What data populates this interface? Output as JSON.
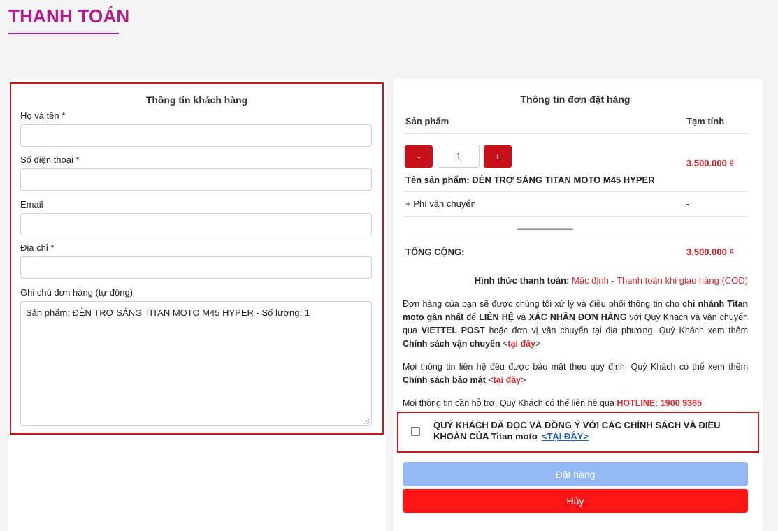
{
  "page": {
    "title": "THANH TOÁN"
  },
  "customer": {
    "section_title": "Thông tin khách hàng",
    "name_label": "Họ và tên *",
    "phone_label": "Số điện thoại *",
    "email_label": "Email",
    "address_label": "Địa chỉ *",
    "note_label": "Ghi chú đơn hàng (tự động)",
    "note_value": "Sản phẩm: ĐÈN TRỢ SÁNG TITAN MOTO M45 HYPER - Số lượng: 1"
  },
  "order": {
    "section_title": "Thông tin đơn đặt hàng",
    "col_product": "Sản phẩm",
    "col_subtotal": "Tạm tính",
    "minus_label": "-",
    "plus_label": "+",
    "quantity": "1",
    "product_name": "Tên sản phẩm: ĐÈN TRỢ SÁNG TITAN MOTO M45 HYPER",
    "product_price": "3.500.000 ₫",
    "shipping_label": "+ Phí vận chuyển",
    "shipping_value": "-",
    "separator": "___________",
    "total_label": "TỔNG CỘNG:",
    "total_value": "3.500.000 ₫",
    "payment_label": "Hình thức thanh toán:",
    "payment_value": "Mặc định - Thanh toán khi giao hàng (COD)"
  },
  "info": {
    "p1_a": "Đơn hàng của bạn sẽ được chúng tôi xử lý và điều phối thông tin cho ",
    "p1_b": "chi nhánh Titan moto gần nhất",
    "p1_c": " để ",
    "p1_d": "LIÊN HỆ",
    "p1_e": " và ",
    "p1_f": "XÁC NHẬN ĐƠN HÀNG",
    "p1_g": " với Quý Khách và vận chuyển qua ",
    "p1_h": "VIETTEL POST",
    "p1_i": " hoặc đơn vị vận chuyển tại địa phương. Quý Khách xem thêm ",
    "p1_j": "Chính sách vận chuyển",
    "p1_link": "tại đây",
    "p2_a": "Mọi thông tin liên hệ đều được bảo mật theo quy định. Quý Khách có thể xem thêm ",
    "p2_b": "Chính sách bảo mật",
    "p2_link": "tại đây",
    "p3_a": "Mọi thông tin cần hỗ trợ, Quý Khách có thể liên hệ qua ",
    "p3_hotline": "HOTLINE: 1900 9365",
    "lt": " <",
    "gt": ">"
  },
  "agreement": {
    "text": "QUÝ KHÁCH ĐÃ ĐỌC VÀ ĐỒNG Ý VỚI CÁC CHÍNH SÁCH VÀ ĐIỀU KHOẢN CỦA Titan moto",
    "link": "<TẠI ĐÂY>"
  },
  "buttons": {
    "order": "Đặt hàng",
    "cancel": "Hủy"
  }
}
